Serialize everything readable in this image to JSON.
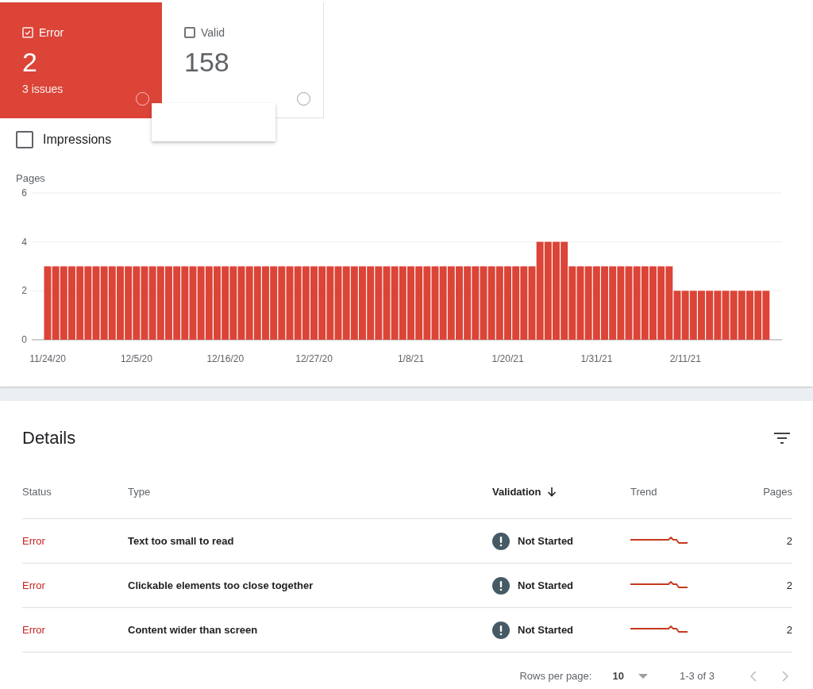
{
  "summary_tiles": [
    {
      "label": "Error",
      "value": "2",
      "sub": "3 issues",
      "checked": true
    },
    {
      "label": "Valid",
      "value": "158",
      "checked": false
    }
  ],
  "impressions": {
    "label": "Impressions",
    "checked": false
  },
  "chart": {
    "chart_data": {
      "type": "bar",
      "ylabel": "Pages",
      "categories": [
        "11/24/20",
        null,
        null,
        null,
        null,
        null,
        null,
        null,
        null,
        null,
        null,
        "12/5/20",
        null,
        null,
        null,
        null,
        null,
        null,
        null,
        null,
        null,
        null,
        "12/16/20",
        null,
        null,
        null,
        null,
        null,
        null,
        null,
        null,
        null,
        null,
        "12/27/20",
        null,
        null,
        null,
        null,
        null,
        null,
        null,
        null,
        null,
        null,
        null,
        "1/8/21",
        null,
        null,
        null,
        null,
        null,
        null,
        null,
        null,
        null,
        null,
        null,
        "1/20/21",
        null,
        null,
        null,
        null,
        null,
        null,
        null,
        null,
        null,
        null,
        "1/31/21",
        null,
        null,
        null,
        null,
        null,
        null,
        null,
        null,
        null,
        null,
        "2/11/21",
        null,
        null,
        null,
        null,
        null,
        null,
        null,
        null,
        null,
        null
      ],
      "series": [
        {
          "color": "#db4437",
          "values": [
            3,
            3,
            3,
            3,
            3,
            3,
            3,
            3,
            3,
            3,
            3,
            3,
            3,
            3,
            3,
            3,
            3,
            3,
            3,
            3,
            3,
            3,
            3,
            3,
            3,
            3,
            3,
            3,
            3,
            3,
            3,
            3,
            3,
            3,
            3,
            3,
            3,
            3,
            3,
            3,
            3,
            3,
            3,
            3,
            3,
            3,
            3,
            3,
            3,
            3,
            3,
            3,
            3,
            3,
            3,
            3,
            3,
            3,
            3,
            3,
            3,
            4,
            4,
            4,
            4,
            3,
            3,
            3,
            3,
            3,
            3,
            3,
            3,
            3,
            3,
            3,
            3,
            3,
            2,
            2,
            2,
            2,
            2,
            2,
            2,
            2,
            2,
            2,
            2,
            2
          ]
        }
      ],
      "ylim": [
        0,
        6
      ],
      "yticks": [
        0,
        2,
        4,
        6
      ]
    }
  },
  "details": {
    "title": "Details",
    "columns": [
      "Status",
      "Type",
      "Validation",
      "Trend",
      "Pages"
    ],
    "rows": [
      {
        "status": "Error",
        "type": "Text too small to read",
        "validation": "Not Started",
        "pages": "2"
      },
      {
        "status": "Error",
        "type": "Clickable elements too close together",
        "validation": "Not Started",
        "pages": "2"
      },
      {
        "status": "Error",
        "type": "Content wider than screen",
        "validation": "Not Started",
        "pages": "2"
      }
    ],
    "footer": {
      "rows_per_page_label": "Rows per page:",
      "rows_per_page": "10",
      "range": "1-3 of 3"
    }
  }
}
